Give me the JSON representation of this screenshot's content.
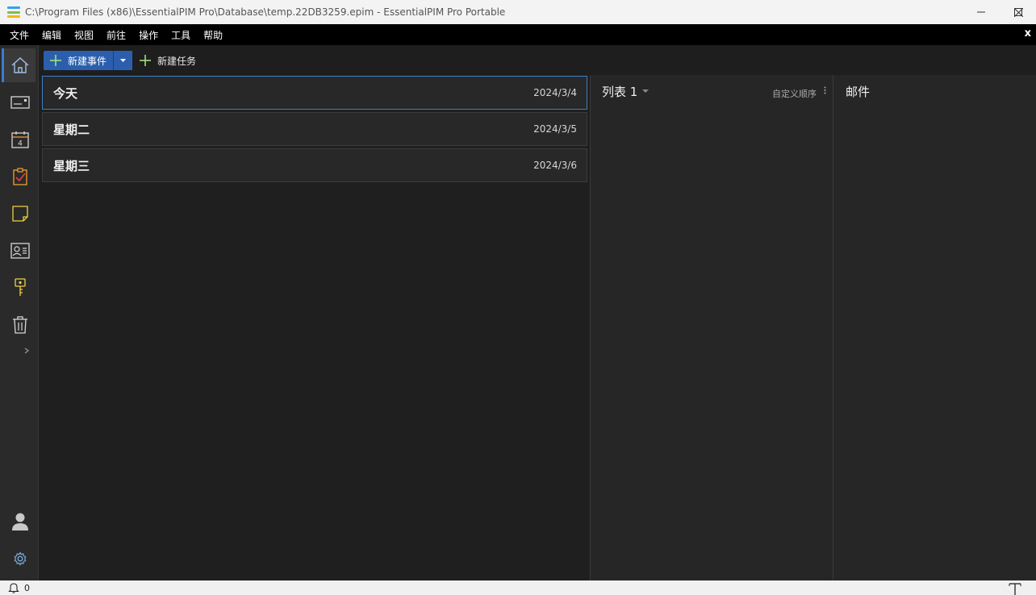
{
  "window": {
    "title": "C:\\Program Files (x86)\\EssentialPIM Pro\\Database\\temp.22DB3259.epim - EssentialPIM Pro Portable"
  },
  "menu": {
    "items": [
      "文件",
      "编辑",
      "视图",
      "前往",
      "操作",
      "工具",
      "帮助"
    ],
    "close_label": "x"
  },
  "toolbar": {
    "new_event_label": "新建事件",
    "new_task_label": "新建任务"
  },
  "days": [
    {
      "name": "今天",
      "date": "2024/3/4"
    },
    {
      "name": "星期二",
      "date": "2024/3/5"
    },
    {
      "name": "星期三",
      "date": "2024/3/6"
    }
  ],
  "tasks_panel": {
    "title": "列表 1",
    "sort_label": "自定义顺序"
  },
  "mail_panel": {
    "title": "邮件"
  },
  "statusbar": {
    "notification_count": "0"
  },
  "nav": {
    "calendar_day": "4",
    "items": [
      "home-icon",
      "email-icon",
      "calendar-icon",
      "tasks-icon",
      "notes-icon",
      "contacts-icon",
      "passwords-icon",
      "trash-icon"
    ]
  },
  "colors": {
    "accent": "#2b5fad",
    "active_border": "#3d7fc5"
  }
}
